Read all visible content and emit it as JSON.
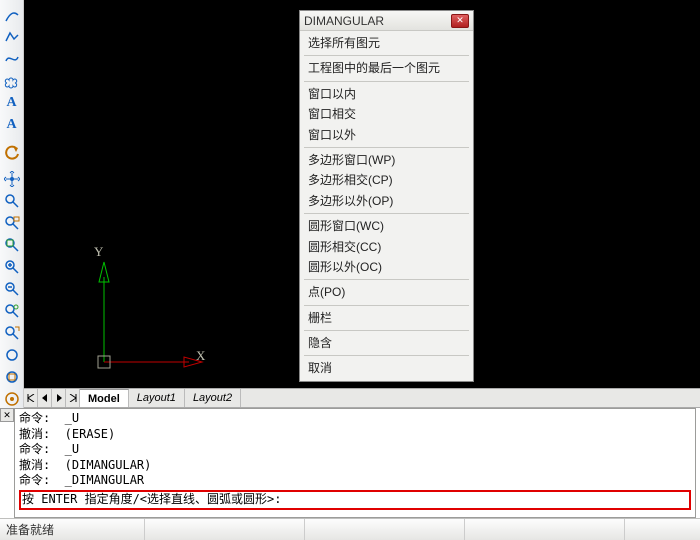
{
  "toolbar": {
    "icons": [
      "arc-icon",
      "polyline-icon",
      "spline-icon",
      "cloud-icon",
      "text-single-icon",
      "text-multi-icon",
      "undo-icon",
      "redo-icon",
      "pan-icon",
      "zoom-box-icon",
      "zoom-extents-icon",
      "zoom-window-icon",
      "zoom-in-icon",
      "zoom-out-icon",
      "zoom-realtime-icon",
      "zoom-dynamic-icon",
      "circle-icon",
      "rectangle-icon",
      "donut-icon"
    ]
  },
  "dialog": {
    "title": "DIMANGULAR",
    "groups": [
      [
        "选择所有图元"
      ],
      [
        "工程图中的最后一个图元"
      ],
      [
        "窗口以内",
        "窗口相交",
        "窗口以外"
      ],
      [
        "多边形窗口(WP)",
        "多边形相交(CP)",
        "多边形以外(OP)"
      ],
      [
        "圆形窗口(WC)",
        "圆形相交(CC)",
        "圆形以外(OC)"
      ],
      [
        "点(PO)"
      ],
      [
        "栅栏"
      ],
      [
        "隐含"
      ],
      [
        "取消"
      ]
    ]
  },
  "tabs": {
    "items": [
      "Model",
      "Layout1",
      "Layout2"
    ],
    "active": 0
  },
  "ucs": {
    "x_label": "X",
    "y_label": "Y"
  },
  "command": {
    "lines": [
      "命令:  _U",
      "撤消:  (ERASE)",
      "命令:  _U",
      "撤消:  (DIMANGULAR)",
      "命令:  _DIMANGULAR"
    ],
    "prompt": "按 ENTER 指定角度/<选择直线、圆弧或圆形>:"
  },
  "status": {
    "text": "准备就绪"
  }
}
